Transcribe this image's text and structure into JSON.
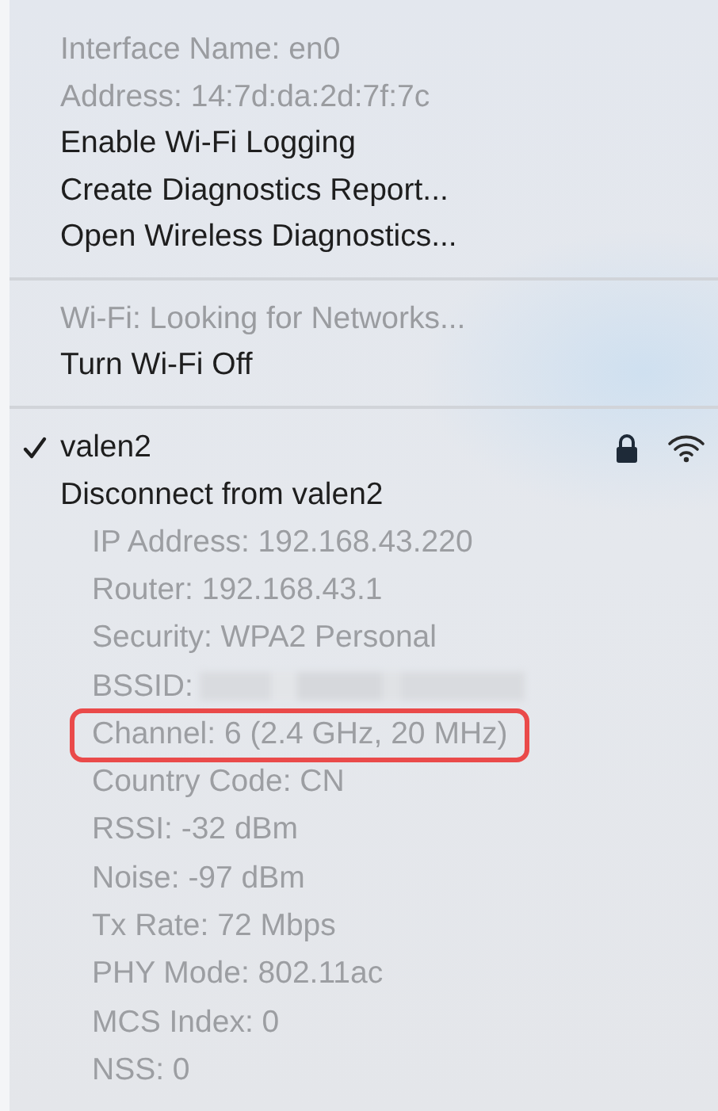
{
  "sections": [
    {
      "items": [
        {
          "text": "Interface Name: en0",
          "kind": "info"
        },
        {
          "text": "Address: 14:7d:da:2d:7f:7c",
          "kind": "info"
        },
        {
          "text": "Enable Wi-Fi Logging",
          "kind": "action"
        },
        {
          "text": "Create Diagnostics Report...",
          "kind": "action"
        },
        {
          "text": "Open Wireless Diagnostics...",
          "kind": "action"
        }
      ]
    },
    {
      "items": [
        {
          "text": "Wi-Fi: Looking for Networks...",
          "kind": "info"
        },
        {
          "text": "Turn Wi-Fi Off",
          "kind": "action"
        }
      ]
    }
  ],
  "network": {
    "name": "valen2",
    "checked": true,
    "locked": true,
    "action": "Disconnect from valen2",
    "details": [
      {
        "text": "IP Address: 192.168.43.220",
        "kind": "plain",
        "highlighted": false
      },
      {
        "text": "Router: 192.168.43.1",
        "kind": "plain",
        "highlighted": false
      },
      {
        "text": "Security: WPA2 Personal",
        "kind": "plain",
        "highlighted": false
      },
      {
        "text": "BSSID:",
        "kind": "redacted",
        "highlighted": false
      },
      {
        "text": "Channel: 6 (2.4 GHz, 20 MHz)",
        "kind": "plain",
        "highlighted": true
      },
      {
        "text": "Country Code: CN",
        "kind": "plain",
        "highlighted": false
      },
      {
        "text": "RSSI: -32 dBm",
        "kind": "plain",
        "highlighted": false
      },
      {
        "text": "Noise: -97 dBm",
        "kind": "plain",
        "highlighted": false
      },
      {
        "text": "Tx Rate: 72 Mbps",
        "kind": "plain",
        "highlighted": false
      },
      {
        "text": "PHY Mode: 802.11ac",
        "kind": "plain",
        "highlighted": false
      },
      {
        "text": "MCS Index: 0",
        "kind": "plain",
        "highlighted": false
      },
      {
        "text": "NSS: 0",
        "kind": "plain",
        "highlighted": false
      }
    ]
  }
}
